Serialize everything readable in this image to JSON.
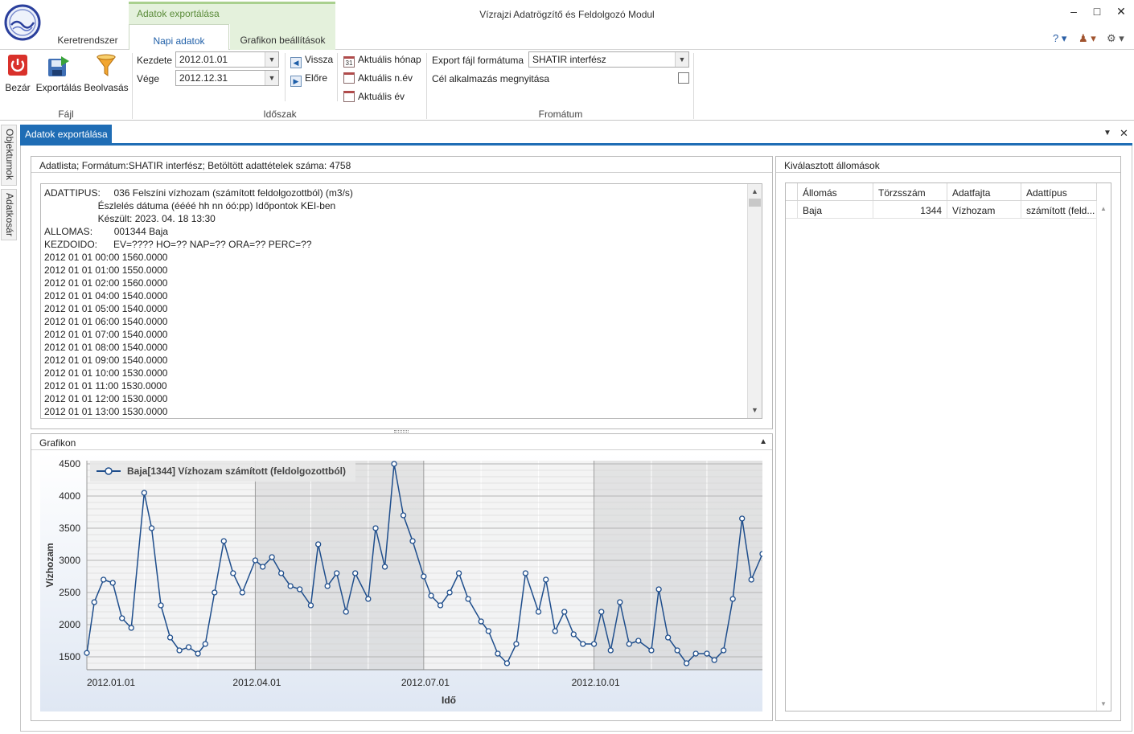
{
  "window": {
    "title": "Vízrajzi Adatrögzítő és Feldolgozó Modul",
    "context_group": "Adatok exportálása"
  },
  "ribbon_tabs": [
    "Keretrendszer",
    "Napi adatok",
    "Grafikon beállítások"
  ],
  "ribbon": {
    "file": {
      "group": "Fájl",
      "close": "Bezár",
      "export": "Exportálás",
      "load": "Beolvasás"
    },
    "period": {
      "group": "Időszak",
      "start_label": "Kezdete",
      "start_value": "2012.01.01",
      "end_label": "Vége",
      "end_value": "2012.12.31",
      "back": "Vissza",
      "forward": "Előre",
      "current_month": "Aktuális hónap",
      "current_hyear": "Aktuális n.év",
      "current_year": "Aktuális év"
    },
    "format": {
      "group": "Fromátum",
      "export_label": "Export fájl formátuma",
      "export_value": "SHATIR interfész",
      "open_target": "Cél alkalmazás megnyitása"
    }
  },
  "side_tabs": [
    "Objektumok",
    "Adatkosár"
  ],
  "document_tab": "Adatok exportálása",
  "datalist": {
    "header": "Adatlista; Formátum:SHATIR interfész; Betöltött adattételek száma: 4758",
    "lines": [
      "ADATTIPUS:     036 Felszíni vízhozam (számított feldolgozottból) (m3/s)",
      "                    Észlelés dátuma (éééé hh nn óó:pp) Időpontok KEI-ben",
      "                    Készült: 2023. 04. 18 13:30",
      "ALLOMAS:        001344 Baja",
      "KEZDOIDO:      EV=???? HO=?? NAP=?? ORA=?? PERC=??",
      "2012 01 01 00:00 1560.0000",
      "2012 01 01 01:00 1550.0000",
      "2012 01 01 02:00 1560.0000",
      "2012 01 01 04:00 1540.0000",
      "2012 01 01 05:00 1540.0000",
      "2012 01 01 06:00 1540.0000",
      "2012 01 01 07:00 1540.0000",
      "2012 01 01 08:00 1540.0000",
      "2012 01 01 09:00 1540.0000",
      "2012 01 01 10:00 1530.0000",
      "2012 01 01 11:00 1530.0000",
      "2012 01 01 12:00 1530.0000",
      "2012 01 01 13:00 1530.0000"
    ]
  },
  "stations": {
    "header": "Kiválasztott állomások",
    "columns": [
      "Állomás",
      "Törzsszám",
      "Adatfajta",
      "Adattípus"
    ],
    "rows": [
      [
        "Baja",
        "1344",
        "Vízhozam",
        "számított (feld..."
      ]
    ]
  },
  "chart_panel": {
    "header": "Grafikon"
  },
  "chart_data": {
    "type": "scatter",
    "legend": "Baja[1344] Vízhozam számított (feldolgozottból)",
    "legend_position": "top-left",
    "xlabel": "Idő",
    "ylabel": "Vízhozam",
    "xlim": [
      "2012-01-01",
      "2012-12-31"
    ],
    "ylim": [
      1300,
      4550
    ],
    "yticks": [
      1500,
      2000,
      2500,
      3000,
      3500,
      4000,
      4500
    ],
    "xticks": [
      "2012.01.01",
      "2012.04.01",
      "2012.07.01",
      "2012.10.01"
    ],
    "grid": true,
    "series_color": "#1f4e8c",
    "series": [
      {
        "name": "Baja[1344] Vízhozam számított (feldolgozottból)",
        "x": [
          "2012-01-01",
          "2012-01-05",
          "2012-01-10",
          "2012-01-15",
          "2012-01-20",
          "2012-01-25",
          "2012-02-01",
          "2012-02-05",
          "2012-02-10",
          "2012-02-15",
          "2012-02-20",
          "2012-02-25",
          "2012-03-01",
          "2012-03-05",
          "2012-03-10",
          "2012-03-15",
          "2012-03-20",
          "2012-03-25",
          "2012-04-01",
          "2012-04-05",
          "2012-04-10",
          "2012-04-15",
          "2012-04-20",
          "2012-04-25",
          "2012-05-01",
          "2012-05-05",
          "2012-05-10",
          "2012-05-15",
          "2012-05-20",
          "2012-05-25",
          "2012-06-01",
          "2012-06-05",
          "2012-06-10",
          "2012-06-15",
          "2012-06-20",
          "2012-06-25",
          "2012-07-01",
          "2012-07-05",
          "2012-07-10",
          "2012-07-15",
          "2012-07-20",
          "2012-07-25",
          "2012-08-01",
          "2012-08-05",
          "2012-08-10",
          "2012-08-15",
          "2012-08-20",
          "2012-08-25",
          "2012-09-01",
          "2012-09-05",
          "2012-09-10",
          "2012-09-15",
          "2012-09-20",
          "2012-09-25",
          "2012-10-01",
          "2012-10-05",
          "2012-10-10",
          "2012-10-15",
          "2012-10-20",
          "2012-10-25",
          "2012-11-01",
          "2012-11-05",
          "2012-11-10",
          "2012-11-15",
          "2012-11-20",
          "2012-11-25",
          "2012-12-01",
          "2012-12-05",
          "2012-12-10",
          "2012-12-15",
          "2012-12-20",
          "2012-12-25",
          "2012-12-31"
        ],
        "values": [
          1560,
          2350,
          2700,
          2650,
          2100,
          1950,
          4050,
          3500,
          2300,
          1800,
          1600,
          1650,
          1550,
          1700,
          2500,
          3300,
          2800,
          2500,
          3000,
          2900,
          3050,
          2800,
          2600,
          2550,
          2300,
          3250,
          2600,
          2800,
          2200,
          2800,
          2400,
          3500,
          2900,
          4500,
          3700,
          3300,
          2750,
          2450,
          2300,
          2500,
          2800,
          2400,
          2050,
          1900,
          1550,
          1400,
          1700,
          2800,
          2200,
          2700,
          1900,
          2200,
          1850,
          1700,
          1700,
          2200,
          1600,
          2350,
          1700,
          1750,
          1600,
          2550,
          1800,
          1600,
          1400,
          1550,
          1550,
          1450,
          1600,
          2400,
          3650,
          2700,
          3100
        ]
      }
    ]
  }
}
